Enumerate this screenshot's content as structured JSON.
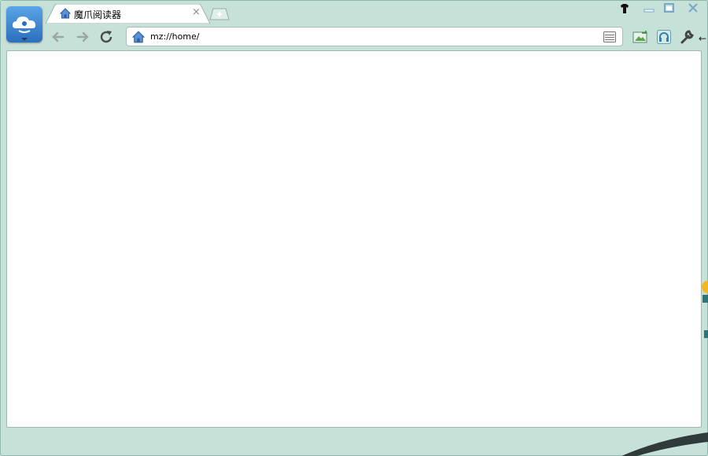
{
  "window": {
    "app_icon": "cloud-reader-logo",
    "controls": [
      {
        "name": "skin-button",
        "icon": "tshirt-icon"
      },
      {
        "name": "minimize-button",
        "icon": "minimize-icon"
      },
      {
        "name": "maximize-button",
        "icon": "maximize-icon"
      },
      {
        "name": "close-button",
        "icon": "close-icon"
      }
    ]
  },
  "tabs": [
    {
      "title": "魔爪阅读器",
      "icon": "home-icon",
      "close_glyph": "×",
      "active": true
    }
  ],
  "toolbar": {
    "back_icon": "back-arrow-icon",
    "forward_icon": "forward-arrow-icon",
    "reload_icon": "reload-icon",
    "address": "mz://home/",
    "address_icon": "home-icon",
    "page_menu_icon": "page-menu-icon",
    "tools": [
      "image-folder-icon",
      "headphones-icon",
      "wrench-icon"
    ],
    "extra_glyph": "←"
  },
  "colors": {
    "frame": "#c5e0d8",
    "content_bg": "#ffffff",
    "logo": "#2b6fbd",
    "accent": "#f2b822"
  }
}
